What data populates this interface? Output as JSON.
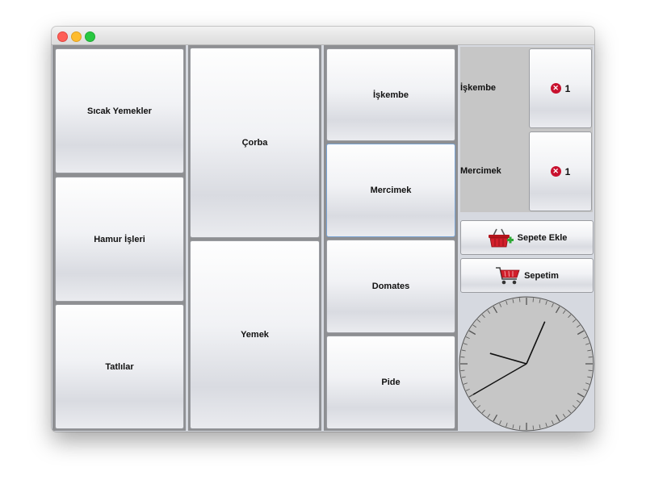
{
  "window": {
    "traffic_lights": [
      "close",
      "minimize",
      "zoom"
    ]
  },
  "categories": [
    {
      "label": "Sıcak Yemekler"
    },
    {
      "label": "Hamur İşleri"
    },
    {
      "label": "Tatlılar"
    }
  ],
  "subcategories": [
    {
      "label": "Çorba"
    },
    {
      "label": "Yemek"
    }
  ],
  "products": [
    {
      "label": "İşkembe"
    },
    {
      "label": "Mercimek"
    },
    {
      "label": "Domates"
    },
    {
      "label": "Pide"
    }
  ],
  "cart": {
    "items": [
      {
        "name": "İşkembe",
        "quantity": "1"
      },
      {
        "name": "Mercimek",
        "quantity": "1"
      }
    ],
    "remove_icon": "red-x-circle-icon",
    "add_to_cart_label": "Sepete Ekle",
    "add_to_cart_icon": "basket-plus-icon",
    "my_cart_label": "Sepetim",
    "my_cart_icon": "shopping-cart-icon"
  },
  "clock": {
    "hour": 12,
    "minute": 47,
    "second": 40
  },
  "colors": {
    "window_bg": "#d6d9e0",
    "remove_red": "#c8102e",
    "cart_panel": "#c6c6c6"
  }
}
